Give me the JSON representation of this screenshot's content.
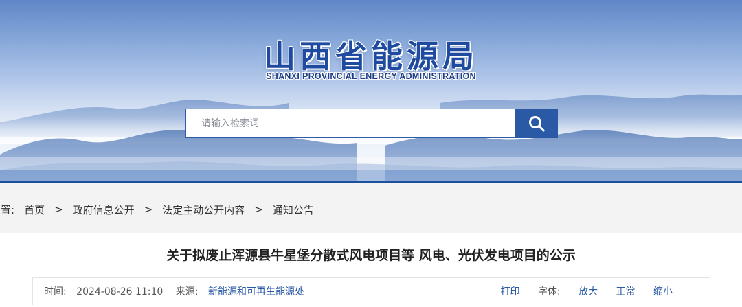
{
  "header": {
    "title": "山西省能源局",
    "subtitle": "SHANXI PROVINCIAL ENERGY ADMINISTRATION"
  },
  "search": {
    "placeholder": "请输入检索词",
    "icon": "search-icon"
  },
  "breadcrumb": {
    "label": "位置:",
    "items": [
      "首页",
      "政府信息公开",
      "法定主动公开内容",
      "通知公告"
    ],
    "separator": ">"
  },
  "article": {
    "title": "关于拟废止浑源县牛星堡分散式风电项目等 风电、光伏发电项目的公示",
    "time_label": "时间:",
    "time_value": "2024-08-26 11:10",
    "source_label": "来源:",
    "source_value": "新能源和可再生能源处",
    "print_label": "打印",
    "font_label": "字体:",
    "font_large": "放大",
    "font_normal": "正常",
    "font_small": "缩小"
  },
  "colors": {
    "brand_blue": "#1e4aa0",
    "search_button": "#2a5aa6",
    "breadcrumb_bg": "#f3f3f3"
  }
}
